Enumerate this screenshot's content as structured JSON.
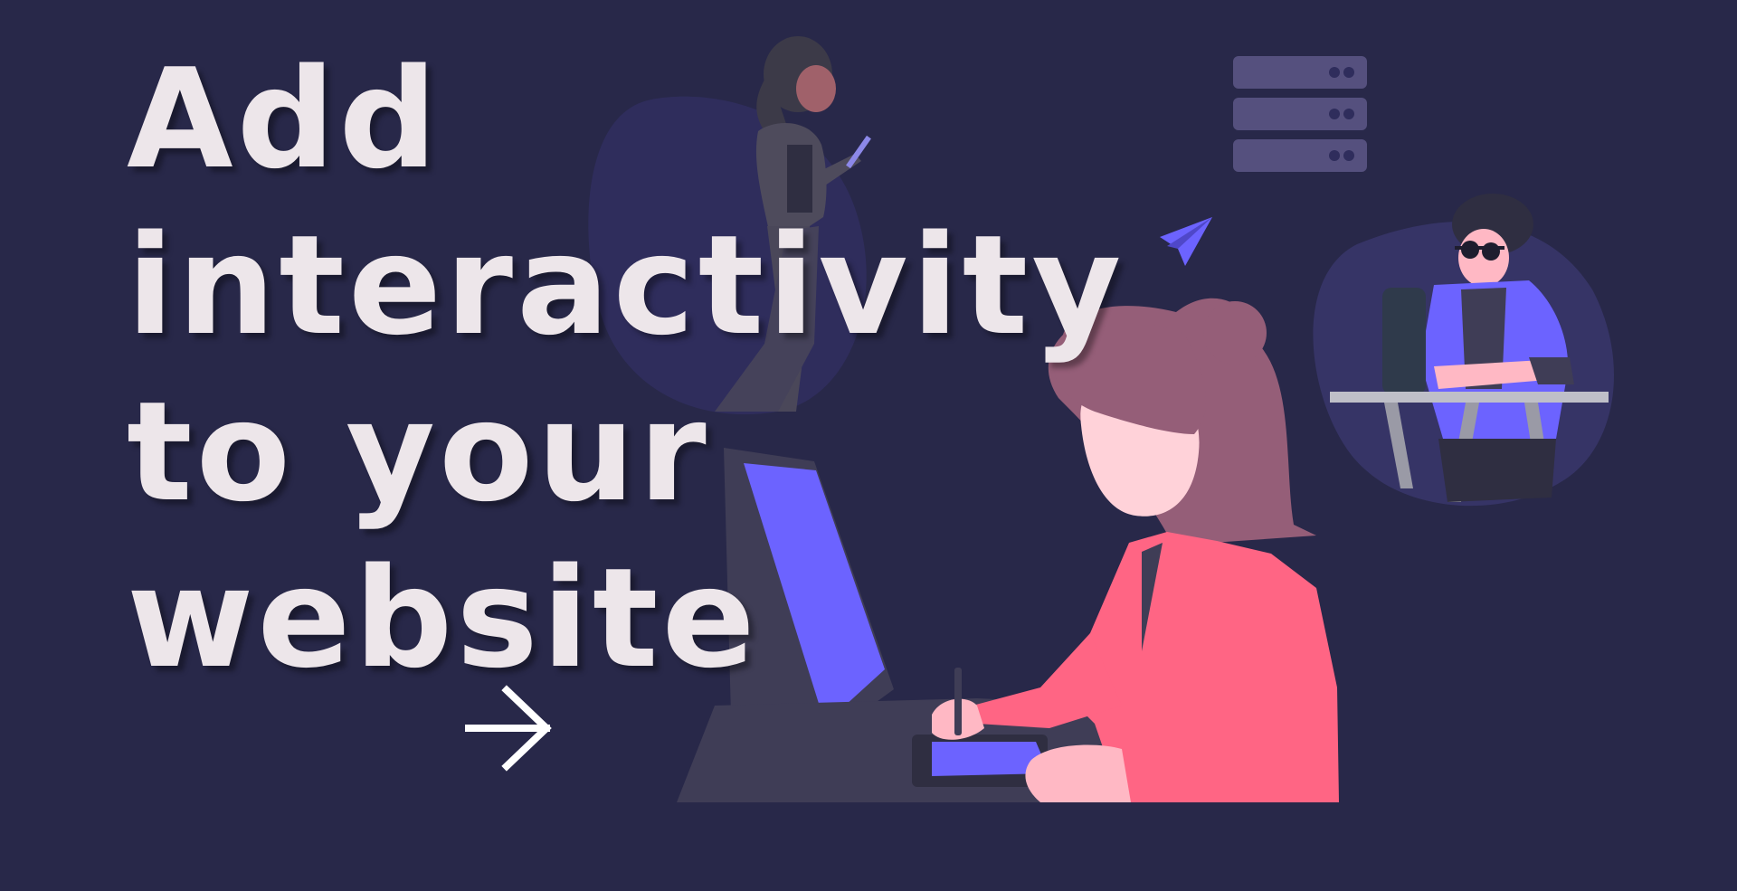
{
  "headline": {
    "line1": "Add",
    "line2": "interactivity",
    "line3": "to your",
    "line4": "website"
  },
  "icons": {
    "arrow": "arrow-right-icon",
    "server": "server-stack-icon",
    "paper_plane": "paper-plane-icon"
  },
  "colors": {
    "background": "#282849",
    "headline": "#EDE6EA",
    "accent": "#6C63FF",
    "shirt": "#FF6584",
    "hair": "#955E78",
    "skin": "#FFB8C4",
    "server": "#55507E",
    "blob": "#363466"
  }
}
